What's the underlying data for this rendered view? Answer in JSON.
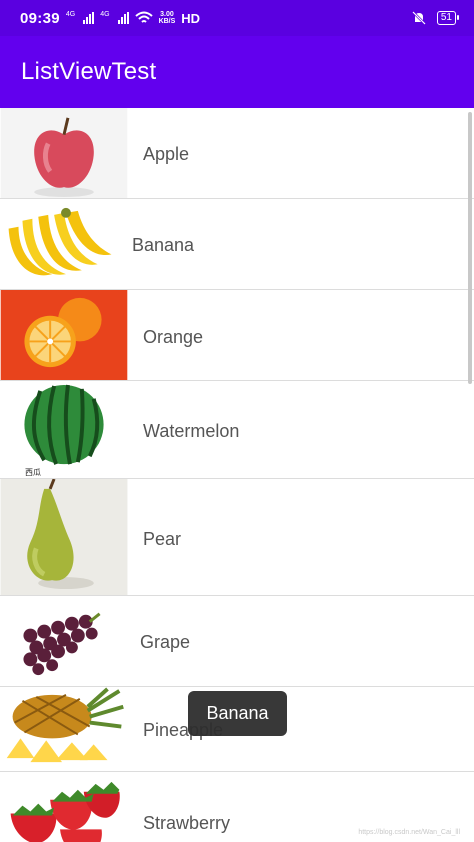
{
  "status_bar": {
    "time": "09:39",
    "net1": "4G",
    "net2": "4G",
    "speed_value": "3.00",
    "speed_unit": "KB/S",
    "hd": "HD",
    "battery": "51",
    "icons": [
      "signal-icon",
      "wifi-icon",
      "mute-icon",
      "battery-icon"
    ]
  },
  "app_bar": {
    "title": "ListViewTest"
  },
  "list": {
    "items": [
      {
        "label": "Apple",
        "icon": "apple-image"
      },
      {
        "label": "Banana",
        "icon": "banana-image"
      },
      {
        "label": "Orange",
        "icon": "orange-image"
      },
      {
        "label": "Watermelon",
        "icon": "watermelon-image",
        "caption": "西瓜"
      },
      {
        "label": "Pear",
        "icon": "pear-image"
      },
      {
        "label": "Grape",
        "icon": "grape-image"
      },
      {
        "label": "Pineapple",
        "icon": "pineapple-image"
      },
      {
        "label": "Strawberry",
        "icon": "strawberry-image"
      }
    ]
  },
  "toast": {
    "text": "Banana"
  },
  "watermark": "https://blog.csdn.net/Wan_Cai_lll",
  "colors": {
    "status_bar": "#5a00e0",
    "app_bar": "#6200ee",
    "label_text": "#555555",
    "divider": "#dcdcdc",
    "toast_bg": "#2e2e2e"
  }
}
